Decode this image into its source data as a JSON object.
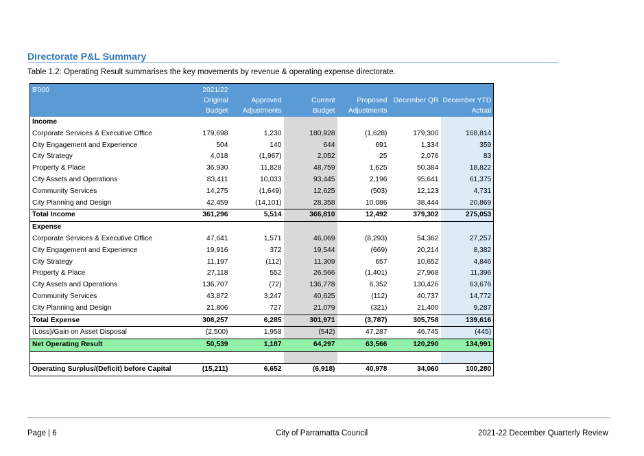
{
  "heading": "Directorate P&L Summary",
  "caption": "Table 1.2: Operating Result summarises the key movements by revenue & operating expense directorate.",
  "table": {
    "columns": [
      {
        "line1": "$'000",
        "line2": "",
        "line3": ""
      },
      {
        "line1": "2021/22",
        "line2": "Original",
        "line3": "Budget"
      },
      {
        "line1": "",
        "line2": "Approved",
        "line3": "Adjustments"
      },
      {
        "line1": "",
        "line2": "Current",
        "line3": "Budget"
      },
      {
        "line1": "",
        "line2": "Proposed",
        "line3": "Adjustments"
      },
      {
        "line1": "",
        "line2": "December QR",
        "line3": ""
      },
      {
        "line1": "",
        "line2": "December YTD",
        "line3": "Actual"
      }
    ],
    "rows": [
      {
        "type": "section",
        "cells": [
          "Income",
          "",
          "",
          "",
          "",
          "",
          ""
        ]
      },
      {
        "type": "data",
        "cells": [
          "Corporate Services & Executive Office",
          "179,698",
          "1,230",
          "180,928",
          "(1,628)",
          "179,300",
          "168,814"
        ]
      },
      {
        "type": "data",
        "cells": [
          "City Engagement and Experience",
          "504",
          "140",
          "644",
          "691",
          "1,334",
          "359"
        ]
      },
      {
        "type": "data",
        "cells": [
          "City Strategy",
          "4,018",
          "(1,967)",
          "2,052",
          "25",
          "2,076",
          "83"
        ]
      },
      {
        "type": "data",
        "cells": [
          "Property & Place",
          "36,930",
          "11,828",
          "48,759",
          "1,625",
          "50,384",
          "18,822"
        ]
      },
      {
        "type": "data",
        "cells": [
          "City Assets and Operations",
          "83,411",
          "10,033",
          "93,445",
          "2,196",
          "95,641",
          "61,375"
        ]
      },
      {
        "type": "data",
        "cells": [
          "Community Services",
          "14,275",
          "(1,649)",
          "12,625",
          "(503)",
          "12,123",
          "4,731"
        ]
      },
      {
        "type": "data",
        "cells": [
          "City Planning and Design",
          "42,459",
          "(14,101)",
          "28,358",
          "10,086",
          "38,444",
          "20,869"
        ]
      },
      {
        "type": "total",
        "cells": [
          "Total Income",
          "361,296",
          "5,514",
          "366,810",
          "12,492",
          "379,302",
          "275,053"
        ]
      },
      {
        "type": "section",
        "cells": [
          "Expense",
          "",
          "",
          "",
          "",
          "",
          ""
        ]
      },
      {
        "type": "data",
        "cells": [
          "Corporate Services & Executive Office",
          "47,641",
          "1,571",
          "46,069",
          "(8,293)",
          "54,362",
          "27,257"
        ]
      },
      {
        "type": "data",
        "cells": [
          "City Engagement and Experience",
          "19,916",
          "372",
          "19,544",
          "(669)",
          "20,214",
          "8,382"
        ]
      },
      {
        "type": "data",
        "cells": [
          "City Strategy",
          "11,197",
          "(112)",
          "11,309",
          "657",
          "10,652",
          "4,846"
        ]
      },
      {
        "type": "data",
        "cells": [
          "Property & Place",
          "27,118",
          "552",
          "26,566",
          "(1,401)",
          "27,968",
          "11,396"
        ]
      },
      {
        "type": "data",
        "cells": [
          "City Assets and Operations",
          "136,707",
          "(72)",
          "136,778",
          "6,352",
          "130,426",
          "63,676"
        ]
      },
      {
        "type": "data",
        "cells": [
          "Community Services",
          "43,872",
          "3,247",
          "40,625",
          "(112)",
          "40,737",
          "14,772"
        ]
      },
      {
        "type": "data",
        "cells": [
          "City Planning and Design",
          "21,806",
          "727",
          "21,079",
          "(321)",
          "21,400",
          "9,287"
        ]
      },
      {
        "type": "total",
        "cells": [
          "Total Expense",
          "308,257",
          "6,285",
          "301,971",
          "(3,787)",
          "305,758",
          "139,616"
        ]
      },
      {
        "type": "plain",
        "cells": [
          "(Loss)/Gain on Asset Disposal",
          "(2,500)",
          "1,958",
          "(542)",
          "47,287",
          "46,745",
          "(445)"
        ]
      },
      {
        "type": "green",
        "cells": [
          "Net Operating Result",
          "50,539",
          "1,187",
          "64,297",
          "63,566",
          "120,290",
          "134,991"
        ]
      },
      {
        "type": "spacer",
        "cells": [
          "",
          "",
          "",
          "",
          "",
          "",
          ""
        ]
      },
      {
        "type": "final",
        "cells": [
          "Operating Surplus/(Deficit) before Capital",
          "(15,211)",
          "6,652",
          "(6,918)",
          "40,978",
          "34,060",
          "100,280"
        ]
      }
    ]
  },
  "footer": {
    "left": "Page | 6",
    "center": "City of Parramatta Council",
    "right": "2021-22 December Quarterly Review"
  },
  "colors": {
    "header_bg": "#5b9bd5",
    "current_budget_shade": "#d9d9d9",
    "ytd_actual_shade": "#ddebf7",
    "net_operating_highlight": "#92f0a8",
    "heading_text": "#2e75b6"
  }
}
